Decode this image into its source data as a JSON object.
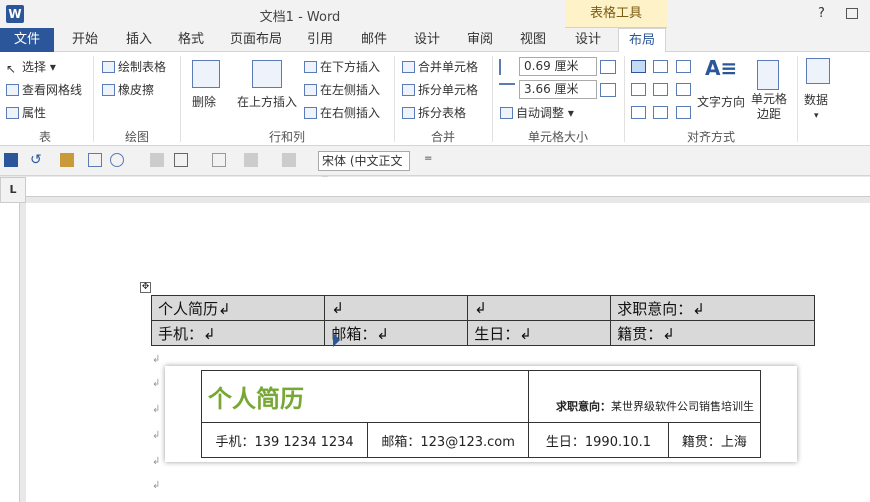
{
  "app": {
    "title": "文档1 - Word",
    "logo_letter": "W",
    "help": "?"
  },
  "context_tool": "表格工具",
  "tabs": [
    "文件",
    "开始",
    "插入",
    "格式",
    "页面布局",
    "引用",
    "邮件",
    "设计",
    "审阅",
    "视图",
    "设计",
    "布局"
  ],
  "ribbon": {
    "table_group": {
      "label": "表",
      "select": "选择",
      "gridlines": "查看网格线",
      "properties": "属性"
    },
    "draw_group": {
      "label": "绘图",
      "draw_table": "绘制表格",
      "eraser": "橡皮擦"
    },
    "rows_cols_group": {
      "label": "行和列",
      "delete": "删除",
      "insert_above": "在上方插入",
      "insert_below": "在下方插入",
      "insert_left": "在左侧插入",
      "insert_right": "在右侧插入"
    },
    "merge_group": {
      "label": "合并",
      "merge_cells": "合并单元格",
      "split_cells": "拆分单元格",
      "split_table": "拆分表格"
    },
    "cell_size_group": {
      "label": "单元格大小",
      "height_value": "0.69 厘米",
      "width_value": "3.66 厘米",
      "autofit": "自动调整"
    },
    "alignment_group": {
      "label": "对齐方式",
      "text_direction": "文字方向",
      "cell_margins": "单元格\n边距"
    },
    "data": "数据"
  },
  "qat": {
    "font_value": "宋体 (中文正文"
  },
  "table1": {
    "rows": [
      [
        "个人简历↲",
        "↲",
        "↲",
        "求职意向：↲"
      ],
      [
        "手机：↲",
        "邮箱：↲",
        "生日：↲",
        "籍贯：↲"
      ]
    ]
  },
  "table2": {
    "title": "个人简历",
    "intent_label": "求职意向：",
    "intent_value": "某世界级软件公司销售培训生",
    "phone": "手机：139 1234 1234",
    "email": "邮箱：123@123.com",
    "birthday": "生日：1990.10.1",
    "origin": "籍贯：上海"
  }
}
